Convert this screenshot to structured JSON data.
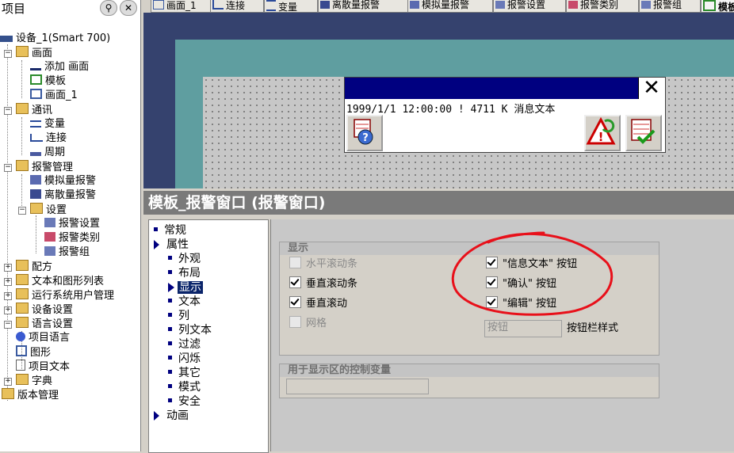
{
  "tree": {
    "title": "项目",
    "items": [
      {
        "label": "设备_1(Smart 700)"
      },
      {
        "label": "画面"
      },
      {
        "label": "添加 画面"
      },
      {
        "label": "模板"
      },
      {
        "label": "画面_1"
      },
      {
        "label": "通讯"
      },
      {
        "label": "变量"
      },
      {
        "label": "连接"
      },
      {
        "label": "周期"
      },
      {
        "label": "报警管理"
      },
      {
        "label": "模拟量报警"
      },
      {
        "label": "离散量报警"
      },
      {
        "label": "设置"
      },
      {
        "label": "报警设置"
      },
      {
        "label": "报警类别"
      },
      {
        "label": "报警组"
      },
      {
        "label": "配方"
      },
      {
        "label": "文本和图形列表"
      },
      {
        "label": "运行系统用户管理"
      },
      {
        "label": "设备设置"
      },
      {
        "label": "语言设置"
      },
      {
        "label": "项目语言"
      },
      {
        "label": "图形"
      },
      {
        "label": "项目文本"
      },
      {
        "label": "字典"
      },
      {
        "label": "版本管理"
      }
    ]
  },
  "tabs": [
    {
      "label": "画面_1"
    },
    {
      "label": "连接"
    },
    {
      "label": "变量"
    },
    {
      "label": "离散量报警"
    },
    {
      "label": "模拟量报警"
    },
    {
      "label": "报警设置"
    },
    {
      "label": "报警类别"
    },
    {
      "label": "报警组"
    },
    {
      "label": "模板"
    }
  ],
  "alarm_window": {
    "line": "1999/1/1  12:00:00  !  4711  K  消息文本",
    "close_glyph": "✕"
  },
  "inspector": {
    "title": "模板_报警窗口 (报警窗口)",
    "nav": [
      {
        "label": "常规"
      },
      {
        "label": "属性"
      },
      {
        "label": "外观"
      },
      {
        "label": "布局"
      },
      {
        "label": "显示"
      },
      {
        "label": "文本"
      },
      {
        "label": "列"
      },
      {
        "label": "列文本"
      },
      {
        "label": "过滤"
      },
      {
        "label": "闪烁"
      },
      {
        "label": "其它"
      },
      {
        "label": "模式"
      },
      {
        "label": "安全"
      },
      {
        "label": "动画"
      }
    ],
    "display_group": {
      "title": "显示",
      "checkboxes": [
        {
          "label": "水平滚动条",
          "checked": false
        },
        {
          "label": "垂直滚动条",
          "checked": true
        },
        {
          "label": "垂直滚动",
          "checked": true
        },
        {
          "label": "网格",
          "checked": false
        },
        {
          "label": "\"信息文本\" 按钮",
          "checked": true
        },
        {
          "label": "\"确认\" 按钮",
          "checked": true
        },
        {
          "label": "\"编辑\" 按钮",
          "checked": true
        }
      ],
      "button_style_value": "按钮",
      "button_style_label": "按钮栏样式"
    },
    "control_group": {
      "title": "用于显示区的控制变量",
      "value": ""
    }
  },
  "colors": {
    "accent": "#0a246a",
    "alarm_bar": "#000080",
    "teal": "#5f9ea0",
    "annotation": "#e8101a"
  }
}
